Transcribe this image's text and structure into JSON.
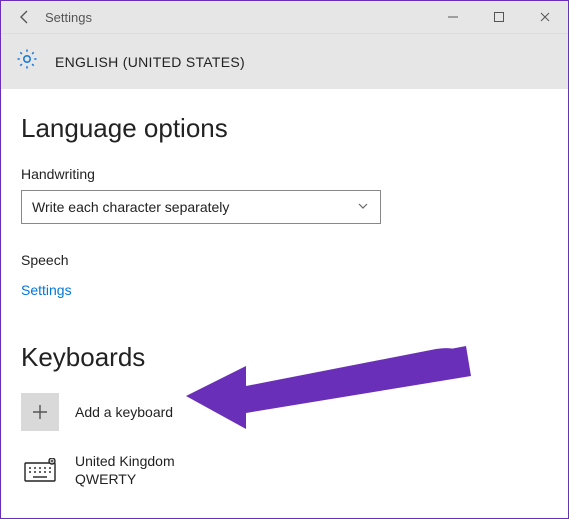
{
  "titlebar": {
    "title": "Settings"
  },
  "subheader": {
    "language_heading": "ENGLISH (UNITED STATES)"
  },
  "sections": {
    "language_options_heading": "Language options",
    "handwriting_label": "Handwriting",
    "handwriting_dropdown_value": "Write each character separately",
    "speech_label": "Speech",
    "speech_link": "Settings",
    "keyboards_heading": "Keyboards",
    "add_keyboard_label": "Add a keyboard",
    "kb_item_name": "United Kingdom",
    "kb_item_layout": "QWERTY"
  }
}
